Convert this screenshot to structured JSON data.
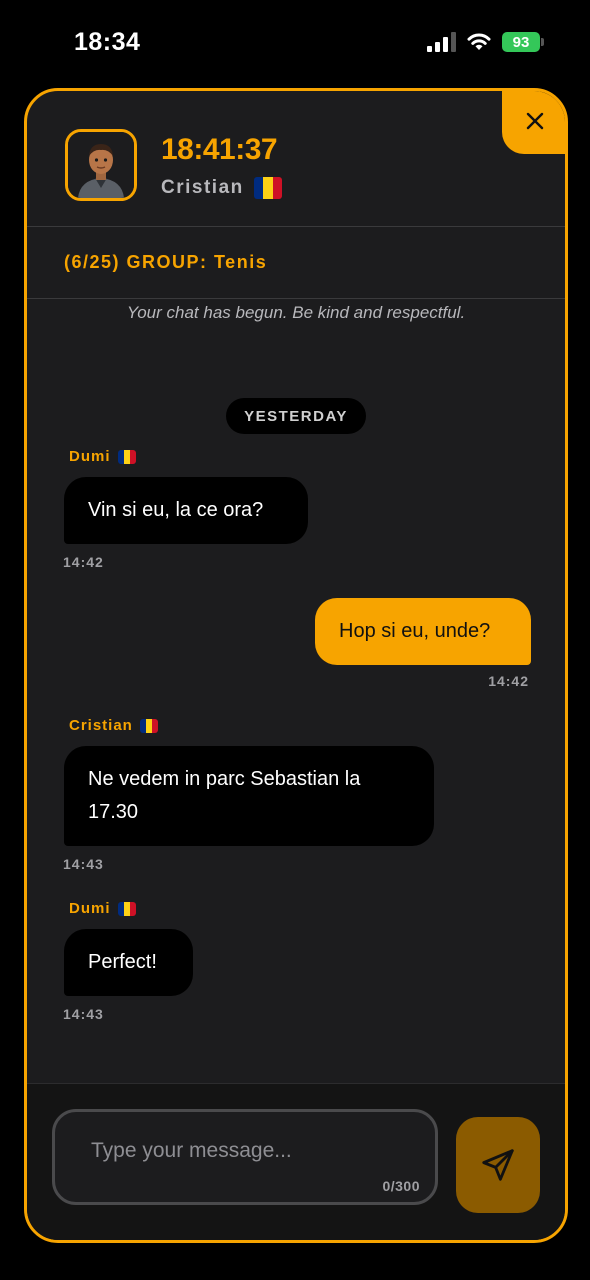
{
  "status_bar": {
    "time": "18:34",
    "battery": "93"
  },
  "header": {
    "timer": "18:41:37",
    "user_name": "Cristian"
  },
  "group": {
    "label": "(6/25) GROUP: Tenis"
  },
  "chat": {
    "notice": "Your chat has begun. Be kind and respectful.",
    "day_label": "YESTERDAY",
    "messages": [
      {
        "sender": "Dumi",
        "text": "Vin si eu, la ce ora?",
        "time": "14:42",
        "outgoing": false
      },
      {
        "sender": "",
        "text": "Hop si eu, unde?",
        "time": "14:42",
        "outgoing": true
      },
      {
        "sender": "Cristian",
        "text": "Ne vedem in parc Sebastian la 17.30",
        "time": "14:43",
        "outgoing": false
      },
      {
        "sender": "Dumi",
        "text": "Perfect!",
        "time": "14:43",
        "outgoing": false
      }
    ]
  },
  "composer": {
    "placeholder": "Type your message...",
    "counter": "0/300"
  },
  "colors": {
    "accent": "#f7a400",
    "panel": "#1c1c1e",
    "bubble_in": "#000000",
    "send_button": "#8b5b00"
  },
  "icons": {
    "close": "close-icon",
    "send": "send-icon",
    "flag": "romania-flag-icon"
  }
}
